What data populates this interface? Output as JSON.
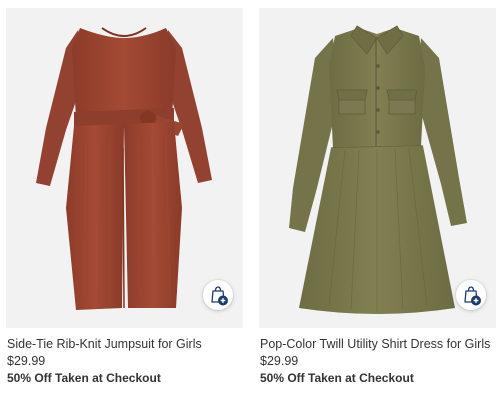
{
  "colors": {
    "image_bg": "#f2f2f2",
    "jumpsuit": "#9e4632",
    "dress": "#7b7a4e",
    "bag_icon": "#1a3a6e"
  },
  "products": [
    {
      "title": "Side-Tie Rib-Knit Jumpsuit for Girls",
      "price": "$29.99",
      "promo": "50% Off Taken at Checkout",
      "add_icon": "shopping-bag-plus-icon"
    },
    {
      "title": "Pop-Color Twill Utility Shirt Dress for Girls",
      "price": "$29.99",
      "promo": "50% Off Taken at Checkout",
      "add_icon": "shopping-bag-plus-icon"
    }
  ]
}
